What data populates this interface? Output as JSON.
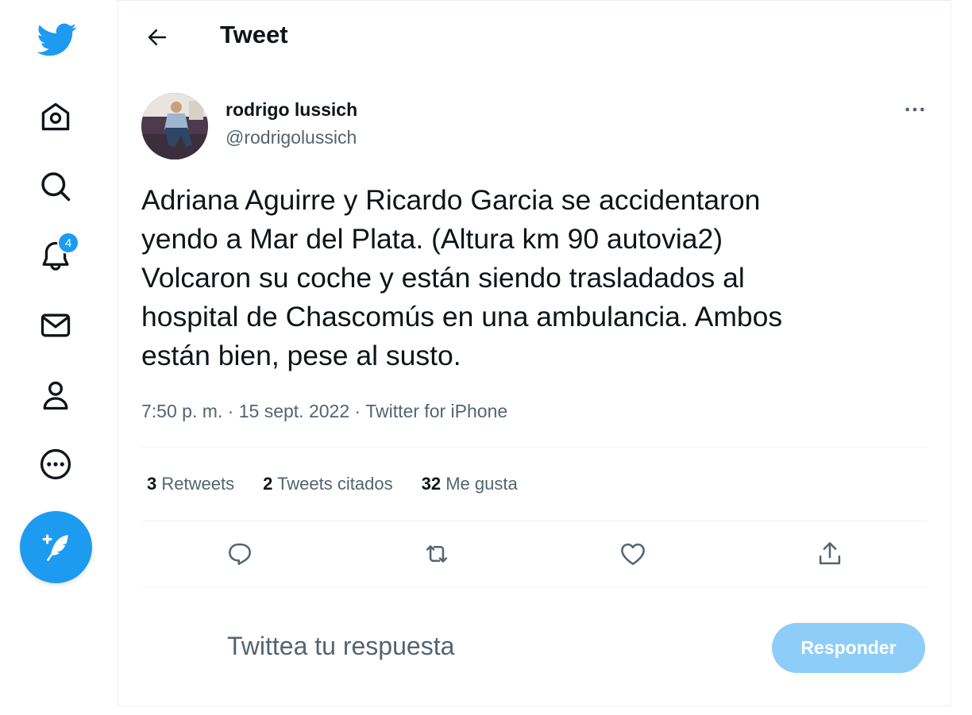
{
  "header": {
    "title": "Tweet"
  },
  "sidebar": {
    "notifications_badge": "4",
    "items": [
      {
        "name": "home-icon"
      },
      {
        "name": "search-icon"
      },
      {
        "name": "notifications-icon"
      },
      {
        "name": "messages-icon"
      },
      {
        "name": "profile-icon"
      },
      {
        "name": "more-icon"
      }
    ]
  },
  "tweet": {
    "author_name": "rodrigo lussich",
    "author_handle": "@rodrigolussich",
    "text": "Adriana Aguirre y Ricardo Garcia se accidentaron\nyendo a Mar del Plata. (Altura km 90 autovia2)\nVolcaron su coche y están siendo trasladados al\nhospital de Chascomús en una ambulancia. Ambos\nestán bien, pese al susto.",
    "time": "7:50 p. m.",
    "date": "15 sept. 2022",
    "source": "Twitter for iPhone",
    "separator": "·"
  },
  "stats": {
    "retweets_count": "3",
    "retweets_label": "Retweets",
    "quotes_count": "2",
    "quotes_label": "Tweets citados",
    "likes_count": "32",
    "likes_label": "Me gusta"
  },
  "reply": {
    "placeholder": "Twittea tu respuesta",
    "button_label": "Responder"
  },
  "colors": {
    "accent": "#1d9bf0",
    "reply_button_disabled": "#8ecdf8",
    "secondary_text": "#536471",
    "primary_text": "#0f1419"
  }
}
